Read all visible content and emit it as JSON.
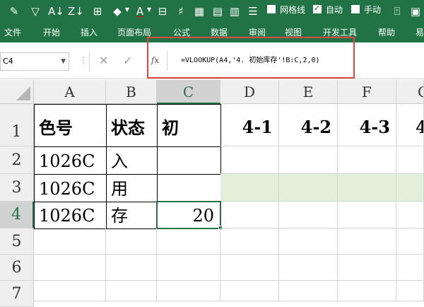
{
  "qat": {
    "gridlines_label": "网格线",
    "gridlines_checked": false,
    "auto_label": "自动",
    "auto_checked": true,
    "manual_label": "手动",
    "manual_checked": false,
    "icons": [
      "format-painter-icon",
      "filter-icon",
      "sort-ascending-icon",
      "sort-descending-icon",
      "borders-icon",
      "fill-color-icon",
      "font-color-icon",
      "text-format-icon",
      "number-format-icon",
      "table-icon",
      "show-desktop-icon",
      "restore-icon"
    ]
  },
  "tabs": [
    "文件",
    "开始",
    "插入",
    "页面布局",
    "公式",
    "数据",
    "审阅",
    "视图",
    "开发工具",
    "帮助",
    "易"
  ],
  "formula_bar": {
    "name_box": "C4",
    "fx_label": "fx",
    "formula": "=VLOOKUP(A4,'4. 初始库存'!B:C,2,0)"
  },
  "grid": {
    "column_headers": [
      "A",
      "B",
      "C",
      "D",
      "E",
      "F",
      "G"
    ],
    "selected_column": "C",
    "row_headers": [
      "1",
      "2",
      "3",
      "4",
      "5",
      "6",
      "7"
    ],
    "selected_row": "4",
    "rows": [
      [
        "色号",
        "状态",
        "初",
        "4-1",
        "4-2",
        "4-3",
        "4"
      ],
      [
        "1026C",
        "入",
        "",
        "",
        "",
        "",
        ""
      ],
      [
        "1026C",
        "用",
        "",
        "",
        "",
        "",
        ""
      ],
      [
        "1026C",
        "存",
        "20",
        "",
        "",
        "",
        ""
      ]
    ],
    "active_cell": "C4"
  },
  "colors": {
    "excel_green": "#217346",
    "highlight_box": "#e0473f",
    "row3_fill": "#e2efda"
  }
}
